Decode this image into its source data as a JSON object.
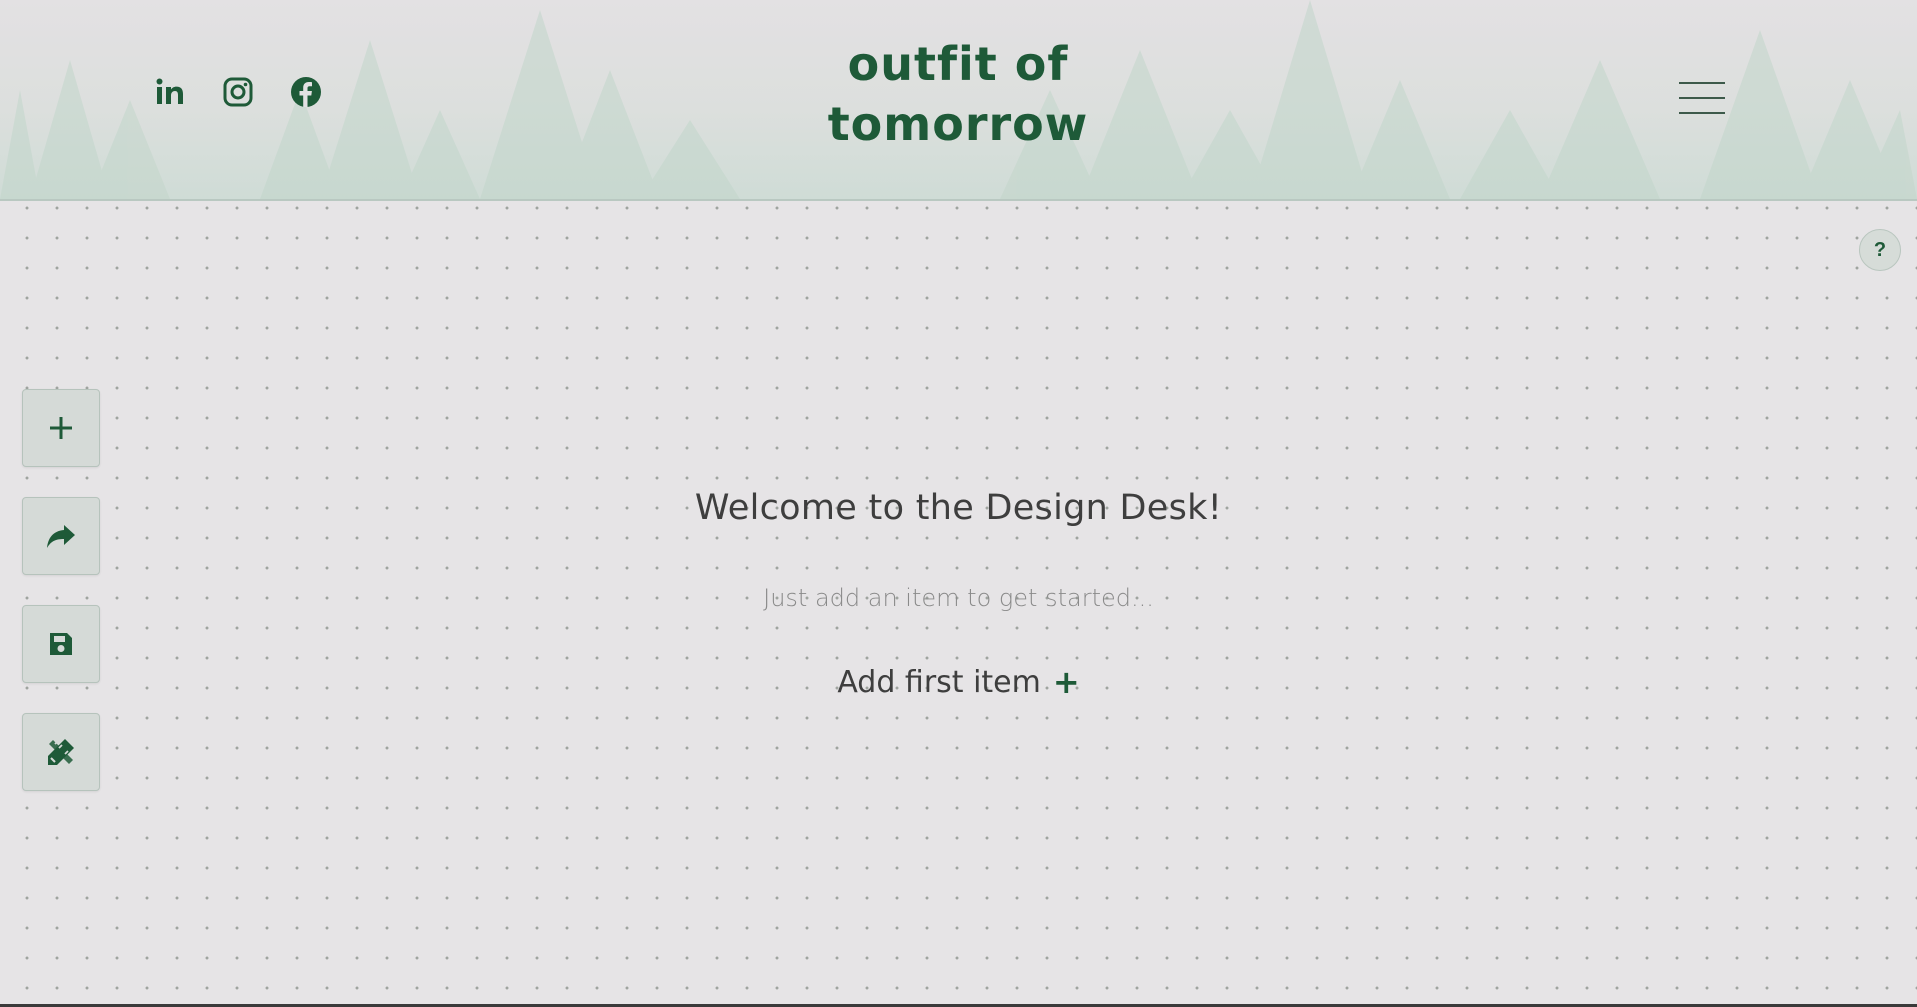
{
  "header": {
    "logo_line1": "outfit of",
    "logo_line2": "tomorrow",
    "social": [
      {
        "name": "linkedin-icon"
      },
      {
        "name": "instagram-icon"
      },
      {
        "name": "facebook-icon"
      }
    ],
    "menu_icon": "hamburger-menu-icon"
  },
  "help": {
    "label": "?"
  },
  "toolbar": {
    "items": [
      {
        "icon": "plus-icon",
        "action": "add"
      },
      {
        "icon": "share-icon",
        "action": "share"
      },
      {
        "icon": "save-icon",
        "action": "save"
      },
      {
        "icon": "design-tools-icon",
        "action": "design"
      }
    ]
  },
  "main": {
    "welcome_title": "Welcome to the Design Desk!",
    "welcome_subtitle": "Just add an item to get started...",
    "add_first_label": "Add first item",
    "add_first_plus": "+"
  },
  "colors": {
    "brand_green": "#1e5a38",
    "background": "#e6e4e6"
  }
}
